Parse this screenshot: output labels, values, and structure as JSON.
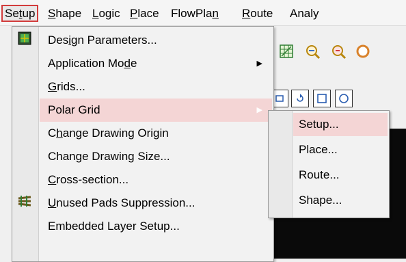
{
  "menubar": {
    "items": [
      {
        "pre": "Se",
        "acc": "t",
        "post": "up"
      },
      {
        "pre": "",
        "acc": "S",
        "post": "hape"
      },
      {
        "pre": "",
        "acc": "L",
        "post": "ogic"
      },
      {
        "pre": "",
        "acc": "P",
        "post": "lace"
      },
      {
        "pre": "FlowPla",
        "acc": "n",
        "post": ""
      },
      {
        "pre": "",
        "acc": "R",
        "post": "oute"
      },
      {
        "pre": "Analy",
        "acc": "",
        "post": ""
      }
    ]
  },
  "setup_menu": {
    "items": [
      {
        "pre": "Des",
        "acc": "i",
        "post": "gn Parameters...",
        "icon": "design-parameters-icon"
      },
      {
        "pre": "Application Mo",
        "acc": "d",
        "post": "e",
        "has_submenu": true
      },
      {
        "pre": "",
        "acc": "G",
        "post": "rids..."
      },
      {
        "pre": "Polar Grid",
        "acc": "",
        "post": "",
        "has_submenu": true,
        "highlighted": true
      },
      {
        "pre": "C",
        "acc": "h",
        "post": "ange Drawing Origin"
      },
      {
        "pre": "Change Drawing Size...",
        "acc": "",
        "post": ""
      },
      {
        "pre": "",
        "acc": "C",
        "post": "ross-section...",
        "icon": "cross-section-icon"
      },
      {
        "pre": "",
        "acc": "U",
        "post": "nused Pads Suppression..."
      },
      {
        "pre": "Embedded Layer Setup...",
        "acc": "",
        "post": ""
      }
    ]
  },
  "polar_submenu": {
    "items": [
      {
        "label": "Setup...",
        "highlighted": true
      },
      {
        "label": "Place..."
      },
      {
        "label": "Route..."
      },
      {
        "label": "Shape..."
      }
    ]
  },
  "colors": {
    "active_border": "#d23b3b",
    "highlight": "#f4d5d5",
    "canvas": "#0a0a0a"
  }
}
